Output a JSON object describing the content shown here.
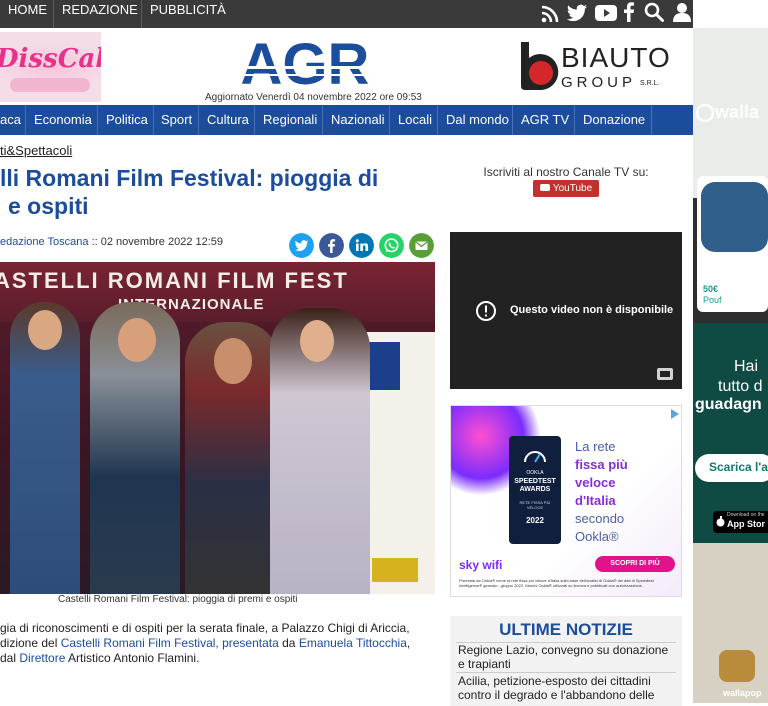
{
  "topnav": {
    "items": [
      {
        "label": "HOME"
      },
      {
        "label": "REDAZIONE"
      },
      {
        "label": "PUBBLICITÀ"
      }
    ],
    "icons": [
      "rss-icon",
      "twitter-icon",
      "youtube-icon",
      "facebook-icon",
      "search-icon",
      "user-icon"
    ]
  },
  "header": {
    "ad_left_text": "DissCake",
    "logo_text": "AGR",
    "updated": "Aggiornato Venerdì 04 novembre 2022 ore 09:53",
    "sponsor_text": "BIAUTO",
    "sponsor_sub": "GROUP",
    "sponsor_srl": "S.R.L."
  },
  "mainnav": {
    "items": [
      {
        "label": "aca"
      },
      {
        "label": "Economia"
      },
      {
        "label": "Politica"
      },
      {
        "label": "Sport"
      },
      {
        "label": "Cultura"
      },
      {
        "label": "Regionali"
      },
      {
        "label": "Nazionali"
      },
      {
        "label": "Locali"
      },
      {
        "label": "Dal mondo"
      },
      {
        "label": "AGR TV"
      },
      {
        "label": "Donazione"
      }
    ]
  },
  "article": {
    "breadcrumb": "ti&Spettacoli",
    "title_line1": "lli Romani Film Festival: pioggia di",
    "title_line2": "e ospiti",
    "byline_author": "edazione Toscana",
    "byline_sep": " :: ",
    "byline_date": "02 novembre 2022 12:59",
    "photo_banner": "ASTELLI ROMANI FILM FEST",
    "photo_banner2": "INTERNAZIONALE",
    "caption": "Castelli Romani Film Festival: pioggia di premi e ospiti",
    "body_line1": "gia di riconoscimenti e di ospiti per la serata finale, a Palazzo Chigi di Ariccia,",
    "body_line2_pre": "dizione del ",
    "body_line2_link": "Castelli Romani Film Festival, presentata",
    "body_line2_mid": " da ",
    "body_line2_link2": "Emanuela Tittocchia",
    "body_line2_post": ",",
    "body_line3_pre": "dal ",
    "body_line3_link": "Direttore",
    "body_line3_post": " Artistico Antonio Flamini."
  },
  "sidebar": {
    "subscribe_text": "Iscriviti al nostro Canale TV su:",
    "youtube_label": "YouTube",
    "video_message": "Questo video non è disponibile",
    "sky_ad": {
      "headline_1": "La rete",
      "headline_2": "fissa più",
      "headline_3": "veloce",
      "headline_4": "d'Italia",
      "headline_5": "secondo",
      "headline_6": "Ookla®",
      "badge_brand": "OOKLA",
      "badge_title": "SPEEDTEST AWARDS",
      "badge_sub": "RETE FISSA PIÙ VELOCE",
      "badge_year": "2022",
      "brand": "sky wifi",
      "cta": "SCOPRI DI PIÙ",
      "fineprint": "Premiata da Ookla® come la rete fissa più veloce d'Italia sulla base dell'analisi di Ookla® dei dati di Speedtest Intelligence® gennaio - giugno 2022. Marchi Ookla® utilizzati su licenza e pubblicati con autorizzazione."
    },
    "news_title": "ULTIME NOTIZIE",
    "news_items": [
      {
        "text": "Regione Lazio, convegno su donazione e trapianti"
      },
      {
        "text": "Acilia, petizione-esposto dei cittadini contro il degrado e l'abbandono delle"
      }
    ]
  },
  "right_ad": {
    "brand": "walla",
    "price": "50€",
    "price_sub": "Pouf",
    "text1": "Hai",
    "text2": "tutto d",
    "text3": "guadagn",
    "cta": "Scarica l'a",
    "store": "App Stor",
    "store_small": "Download on the",
    "footer": "wallapop"
  }
}
